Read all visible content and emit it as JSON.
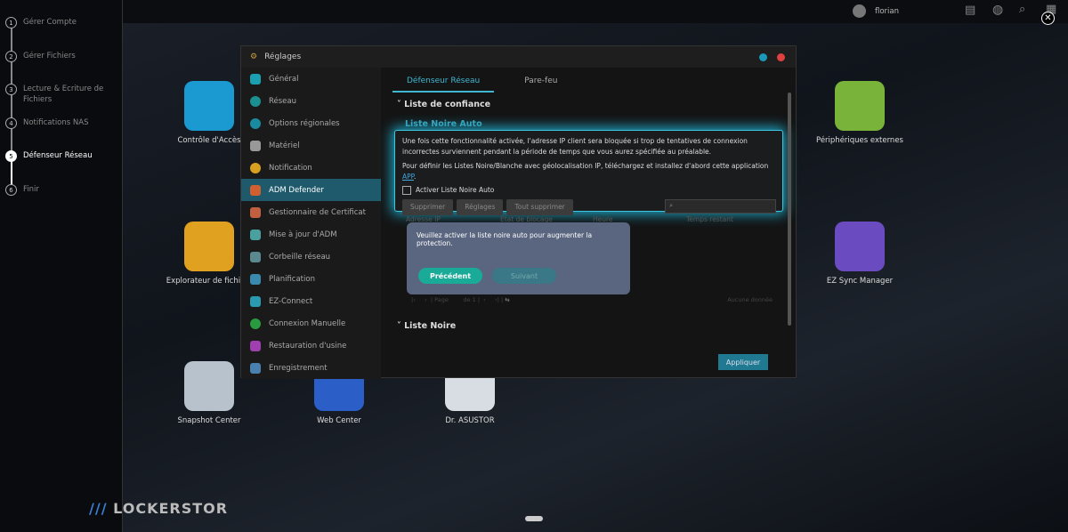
{
  "wizard": {
    "steps": [
      {
        "n": "1",
        "label": "Gérer Compte"
      },
      {
        "n": "2",
        "label": "Gérer Fichiers"
      },
      {
        "n": "3",
        "label": "Lecture & Ecriture de Fichiers"
      },
      {
        "n": "4",
        "label": "Notifications NAS"
      },
      {
        "n": "5",
        "label": "Défenseur Réseau"
      },
      {
        "n": "6",
        "label": "Finir"
      }
    ]
  },
  "topbar": {
    "user": "florian"
  },
  "desktop": {
    "icons": [
      "Contrôle d'Accès",
      "Explorateur de fichiers",
      "Snapshot Center",
      "Web Center",
      "Dr. ASUSTOR",
      "Périphériques externes",
      "EZ Sync Manager"
    ],
    "logo": "LOCKERSTOR"
  },
  "window": {
    "title": "Réglages",
    "sidebar": [
      "Général",
      "Réseau",
      "Options régionales",
      "Matériel",
      "Notification",
      "ADM Defender",
      "Gestionnaire de Certificat",
      "Mise à jour d'ADM",
      "Corbeille réseau",
      "Planification",
      "EZ-Connect",
      "Connexion Manuelle",
      "Restauration d'usine",
      "Enregistrement"
    ],
    "tabs": [
      "Défenseur Réseau",
      "Pare-feu"
    ],
    "trust_section": "Liste de confiance",
    "auto_black": "Liste Noire Auto",
    "desc1": "Une fois cette fonctionnalité activée, l'adresse IP client sera bloquée si trop de tentatives de connexion incorrectes surviennent pendant la période de temps que vous aurez spécifiée au préalable.",
    "desc2": "Pour définir les Listes Noire/Blanche avec géolocalisation IP, téléchargez et installez d'abord cette application ",
    "app_link": "APP",
    "checkbox": "Activer Liste Noire Auto",
    "buttons": {
      "delete": "Supprimer",
      "settings": "Réglages",
      "delete_all": "Tout supprimer"
    },
    "columns": [
      "Adresse IP",
      "État de blocage",
      "Heure",
      "Temps restant"
    ],
    "pager": {
      "page": "Page",
      "of": "de 1",
      "empty": "Aucune donnée"
    },
    "black_section": "Liste Noire",
    "apply": "Appliquer"
  },
  "popup": {
    "text": "Veuillez activer la liste noire auto pour augmenter la protection.",
    "prev": "Précédent",
    "next": "Suivant"
  }
}
